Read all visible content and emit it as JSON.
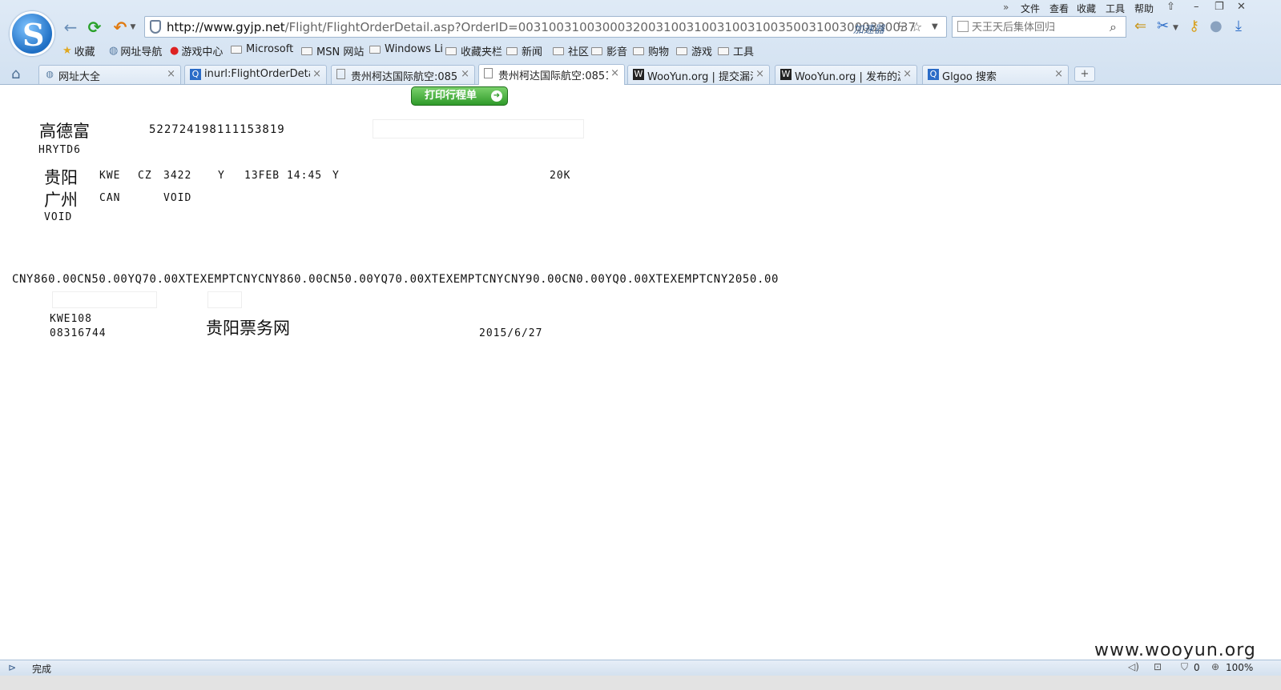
{
  "browser": {
    "url_host": "http://www.gyjp.net",
    "url_path": "/Flight/FlightOrderDetail.asp?OrderID=003100310030003200310031003100310035003100300033003",
    "url_tail": "7",
    "accelerator_label": "加速器",
    "search_placeholder": "天王天后集体回归",
    "menu": [
      "文件",
      "查看",
      "收藏",
      "工具",
      "帮助"
    ],
    "menu_more": "»"
  },
  "favorites": [
    {
      "label": "收藏",
      "icon": "star-icon"
    },
    {
      "label": "网址导航",
      "icon": "globe-icon"
    },
    {
      "label": "游戏中心",
      "icon": "game-icon"
    },
    {
      "label": "Microsoft",
      "icon": "folder-icon"
    },
    {
      "label": "MSN 网站",
      "icon": "folder-icon"
    },
    {
      "label": "Windows Li",
      "icon": "folder-icon"
    },
    {
      "label": "收藏夹栏",
      "icon": "folder-icon"
    },
    {
      "label": "新闻",
      "icon": "folder-icon"
    },
    {
      "label": "社区",
      "icon": "folder-icon"
    },
    {
      "label": "影音",
      "icon": "folder-icon"
    },
    {
      "label": "购物",
      "icon": "folder-icon"
    },
    {
      "label": "游戏",
      "icon": "folder-icon"
    },
    {
      "label": "工具",
      "icon": "folder-icon"
    }
  ],
  "tabs": [
    {
      "label": "网址大全",
      "icon": "globe-icon"
    },
    {
      "label": "inurl:FlightOrderDetail.",
      "icon": "search-icon"
    },
    {
      "label": "贵州柯达国际航空:0851-",
      "icon": "page-icon"
    },
    {
      "label": "贵州柯达国际航空:0851-",
      "icon": "page-icon",
      "active": true
    },
    {
      "label": "WooYun.org | 提交漏洞",
      "icon": "wooyun-icon"
    },
    {
      "label": "WooYun.org | 发布的漏",
      "icon": "wooyun-icon"
    },
    {
      "label": "Glgoo 搜索",
      "icon": "search-icon"
    }
  ],
  "order": {
    "print_button": "打印行程单",
    "passenger_name": "高德富",
    "id_number": "522724198111153819",
    "pnr": "HRYTD6",
    "from_city": "贵阳",
    "from_code": "KWE",
    "airline": "CZ",
    "flight_no": "3422",
    "cabin": "Y",
    "date_time": "13FEB 14:45",
    "fare_class": "Y",
    "baggage": "20K",
    "to_city": "广州",
    "to_code": "CAN",
    "to_status": "VOID",
    "void_line": "VOID",
    "fare_line": "CNY860.00CN50.00YQ70.00XTEXEMPTCNYCNY860.00CN50.00YQ70.00XTEXEMPTCNYCNY90.00CN0.00YQ0.00XTEXEMPTCNY2050.00",
    "agent_code": "KWE108",
    "agent_number": "08316744",
    "agency_name": "贵阳票务网",
    "issue_date": "2015/6/27"
  },
  "status": {
    "text": "完成",
    "counter": "0",
    "zoom": "100%"
  },
  "watermark": "www.wooyun.org"
}
